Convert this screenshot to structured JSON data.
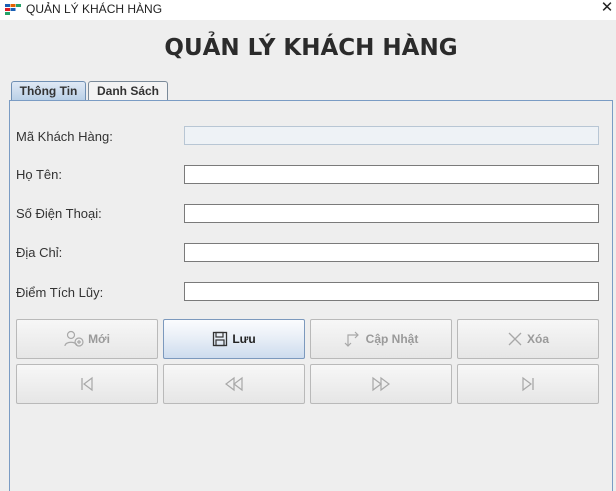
{
  "window": {
    "title": "QUẢN LÝ KHÁCH HÀNG",
    "close_glyph": "✕"
  },
  "heading": "QUẢN LÝ KHÁCH HÀNG",
  "tabs": [
    {
      "label": "Thông Tin",
      "selected": true
    },
    {
      "label": "Danh Sách",
      "selected": false
    }
  ],
  "form": {
    "fields": [
      {
        "label": "Mã Khách Hàng:",
        "value": "",
        "enabled": false
      },
      {
        "label": "Họ Tên:",
        "value": "",
        "enabled": true
      },
      {
        "label": "Số Điện Thoại:",
        "value": "",
        "enabled": true
      },
      {
        "label": "Địa Chỉ:",
        "value": "",
        "enabled": true
      },
      {
        "label": "Điểm Tích Lũy:",
        "value": "",
        "enabled": true
      }
    ]
  },
  "actions": [
    {
      "label": "Mới",
      "icon": "add-user-icon",
      "enabled": false
    },
    {
      "label": "Lưu",
      "icon": "save-icon",
      "enabled": true
    },
    {
      "label": "Cập Nhật",
      "icon": "update-arrows-icon",
      "enabled": false
    },
    {
      "label": "Xóa",
      "icon": "delete-x-icon",
      "enabled": false
    }
  ],
  "navigation": [
    {
      "icon": "first-record-icon",
      "enabled": false
    },
    {
      "icon": "previous-record-icon",
      "enabled": false
    },
    {
      "icon": "next-record-icon",
      "enabled": false
    },
    {
      "icon": "last-record-icon",
      "enabled": false
    }
  ],
  "colors": {
    "background": "#eeeeee",
    "panel_border": "#7a9cc4",
    "active_button": "#cddcee",
    "disabled_text": "#9a9a9a"
  }
}
